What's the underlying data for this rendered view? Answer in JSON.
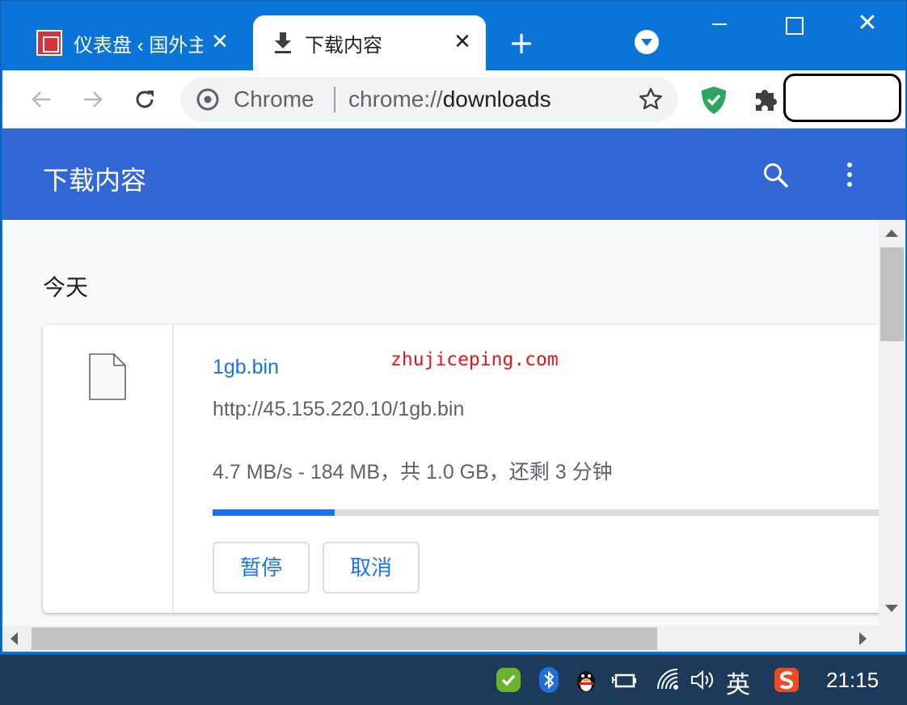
{
  "tabs": [
    {
      "title": "仪表盘 ‹ 国外主",
      "close": "✕",
      "favicon": "site-favicon"
    },
    {
      "title": "下载内容",
      "close": "✕",
      "favicon": "download-icon"
    }
  ],
  "tabstrip": {
    "new_tab": "+"
  },
  "window_controls": {
    "close": "✕"
  },
  "omnibox": {
    "chip": "Chrome",
    "url_scheme": "chrome://",
    "url_host": "downloads"
  },
  "downloads_page": {
    "title": "下载内容",
    "date_heading": "今天",
    "item": {
      "file_name": "1gb.bin",
      "watermark": "zhujiceping.com",
      "url": "http://45.155.220.10/1gb.bin",
      "status": "4.7 MB/s - 184 MB，共 1.0 GB，还剩 3 分钟",
      "progress_percent": 18,
      "pause_label": "暂停",
      "cancel_label": "取消"
    }
  },
  "taskbar": {
    "language": "英",
    "clock": "21:15"
  },
  "colors": {
    "tabstrip": "#0b74d8",
    "header": "#3367d6",
    "link": "#1a73e8"
  }
}
